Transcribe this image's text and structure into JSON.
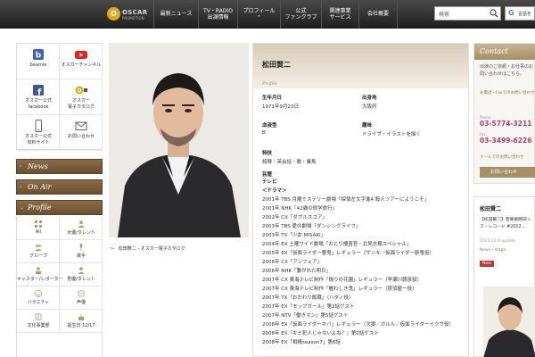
{
  "header": {
    "logo_text": "OSCAR",
    "logo_sub": "PROMOTION",
    "nav": [
      {
        "lines": [
          "最新ニュース"
        ]
      },
      {
        "lines": [
          "TV・RADIO",
          "出演情報"
        ]
      },
      {
        "lines": [
          "プロフィール",
          "^"
        ]
      },
      {
        "lines": [
          "公式",
          "ファンクラブ"
        ]
      },
      {
        "lines": [
          "関連事業",
          "サービス"
        ]
      },
      {
        "lines": [
          "会社概要"
        ]
      }
    ],
    "search_placeholder": "検索",
    "lang_label": "言語を"
  },
  "sidebar": {
    "icons": [
      {
        "label": "beamie",
        "icon": "beamie-icon"
      },
      {
        "label": "オスカーチャンネル",
        "icon": "youtube-icon"
      },
      {
        "label": "オスカー公式\nfacebook",
        "icon": "facebook-icon"
      },
      {
        "label": "オスカー\n電子カタログ",
        "icon": "oscar-catalog-icon"
      },
      {
        "label": "オスカー公式\n有料サイト",
        "icon": "smartphone-icon"
      },
      {
        "label": "お問い合わせ",
        "icon": "mail-icon"
      }
    ],
    "sections": [
      "News",
      "On Air",
      "Profile"
    ],
    "profile_categories": [
      "All",
      "女優/タレント",
      "グループ",
      "歌手",
      "キャスター/レポーター",
      "男優/タレント",
      "バラエティ",
      "声優",
      "文化事業部",
      "誕生日 12/17"
    ]
  },
  "photo": {
    "caption": "松田賢二 - オスカー電子カタログ"
  },
  "profile": {
    "name": "松田賢二",
    "tag": "Profile",
    "birthday_label": "生年月日",
    "birthday": "1971年9月23日",
    "birthplace_label": "出身地",
    "birthplace": "大阪府",
    "blood_label": "血液型",
    "blood": "B",
    "hobby_label": "趣味",
    "hobby": "ドライブ・イラストを描く",
    "skill_label": "特技",
    "skill": "殺陣・英会話・歌・乗馬",
    "career_label": "芸歴",
    "career": [
      {
        "text": "テレビ",
        "strong": true
      },
      {
        "text": "＜ドラマ＞",
        "strong": true
      },
      {
        "text": "2001年 TBS 月曜ミステリー劇場「探偵左文字進4 殺人ツアーにようこそ」",
        "strong": false
      },
      {
        "text": "2001年 NHK「42歳の修学旅行」",
        "strong": false
      },
      {
        "text": "2002年 CX「ダブルスコア」",
        "strong": false
      },
      {
        "text": "2003年 TBS 愛の劇場「ダンシングライフ」",
        "strong": false
      },
      {
        "text": "2003年 TX「少女 MISAKI」",
        "strong": false
      },
      {
        "text": "2004年 EX 土曜ワイド劇場「おとり捜査官・北見志穂スペシャル」",
        "strong": false
      },
      {
        "text": "2005年 EX「仮面ライダー響鬼」レギュラー（ザンキ／仮面ライダー斬鬼役）",
        "strong": false
      },
      {
        "text": "2006年 CX「アンフェア」",
        "strong": false
      },
      {
        "text": "2006年 NHK「繋がれた明日」",
        "strong": false
      },
      {
        "text": "2007年 CX 東海テレビ制作「偽りの花園」レギュラー（早瀬川朝彦役）",
        "strong": false
      },
      {
        "text": "2007年 CX 東海テレビ制作「麗わしき鬼」レギュラー（那須屋一役）",
        "strong": false
      },
      {
        "text": "2007年 TX「おかわり飯蔵」（ハタノ役）",
        "strong": false
      },
      {
        "text": "2007年 EX「モップガール」第2話ゲスト",
        "strong": false
      },
      {
        "text": "2007年 NTV「働きマン」第5話ゲスト",
        "strong": false
      },
      {
        "text": "2008年 EX「仮面ライダーキバ」レギュラー（次狼／ガルル／仮面ライダーイクサ役）",
        "strong": false
      },
      {
        "text": "2008年 EX「キミ犯人じゃないよね？」第2話ゲスト",
        "strong": false
      },
      {
        "text": "2008年 EX「相棒season7」第6話",
        "strong": false
      }
    ]
  },
  "contact": {
    "title": "Contact",
    "desc": "出演のご依頼・お仕事のお問い合わせはこちら。",
    "note": "お電話・Faxでのお問い合わせ",
    "tel_label": "Phone",
    "tel": "03-5774-3211",
    "fax_label": "Fax",
    "fax": "03-3499-6226",
    "mail_note": "メールでのお問い合わせ",
    "button": "お問い合わせ"
  },
  "news": {
    "title": "松田賢二",
    "text": "【松田賢二】音楽劇朗読シズ・レコード #2022…",
    "date": "2023.12.9 update",
    "category": "News・stage",
    "badge": "New"
  },
  "colors": {
    "brand": "#8c6c47",
    "accent": "#c23a6d",
    "new": "#c0392b"
  }
}
